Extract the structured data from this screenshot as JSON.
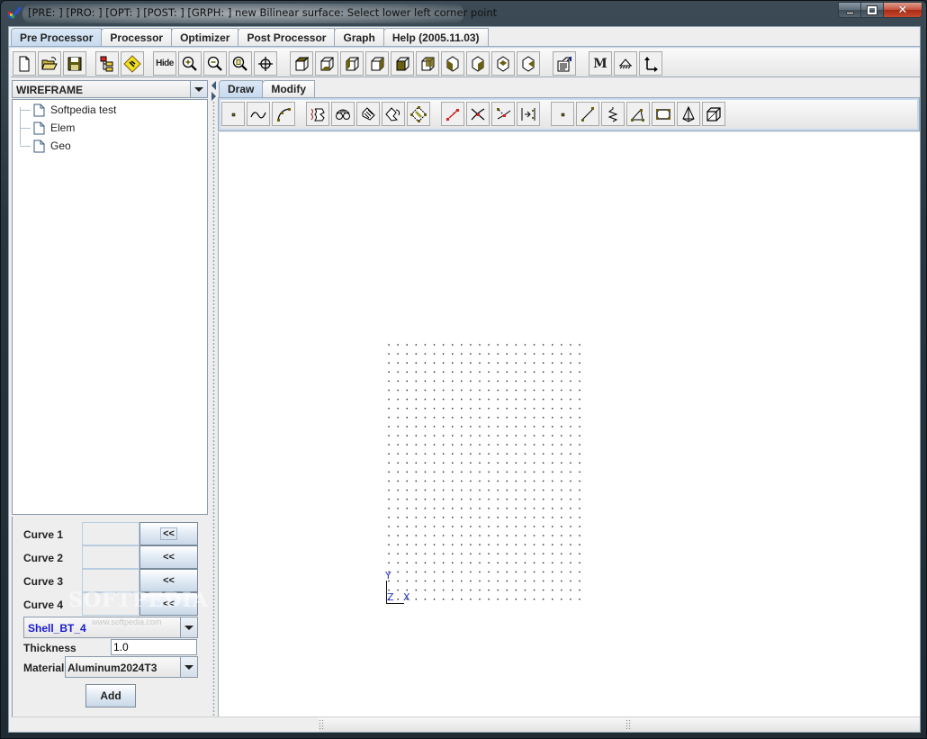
{
  "window": {
    "title": "[PRE: ] [PRO: ] [OPT: ] [POST: ] [GRPH: ] new Bilinear surface: Select lower left corner point",
    "controls": {
      "minimize": "minimize",
      "maximize": "maximize",
      "close": "close"
    }
  },
  "main_tabs": [
    {
      "label": "Pre Processor",
      "active": true
    },
    {
      "label": "Processor",
      "active": false
    },
    {
      "label": "Optimizer",
      "active": false
    },
    {
      "label": "Post Processor",
      "active": false
    },
    {
      "label": "Graph",
      "active": false
    },
    {
      "label": "Help (2005.11.03)",
      "active": false
    }
  ],
  "main_toolbar": {
    "buttons": [
      {
        "icon": "new-file-icon"
      },
      {
        "icon": "open-folder-icon"
      },
      {
        "icon": "save-icon"
      },
      {
        "icon": "tree-hierarchy-icon"
      },
      {
        "icon": "warning-sign-icon"
      },
      {
        "icon": "hide-icon",
        "label": "Hide"
      },
      {
        "icon": "zoom-in-icon"
      },
      {
        "icon": "zoom-out-icon"
      },
      {
        "icon": "zoom-fit-icon"
      },
      {
        "icon": "crosshair-icon"
      },
      {
        "icon": "view-top-icon"
      },
      {
        "icon": "view-bottom-icon"
      },
      {
        "icon": "view-left-icon"
      },
      {
        "icon": "view-right-icon"
      },
      {
        "icon": "view-front-icon"
      },
      {
        "icon": "view-back-icon"
      },
      {
        "icon": "iso-view-1-icon"
      },
      {
        "icon": "iso-view-2-icon"
      },
      {
        "icon": "iso-view-3-icon"
      },
      {
        "icon": "iso-view-4-icon"
      },
      {
        "icon": "properties-icon"
      },
      {
        "icon": "material-icon",
        "label": "M"
      },
      {
        "icon": "boundary-support-icon"
      },
      {
        "icon": "coordinate-axes-icon"
      }
    ]
  },
  "left_panel": {
    "view_mode": "WIREFRAME",
    "tree": [
      {
        "label": "Softpedia test"
      },
      {
        "label": "Elem"
      },
      {
        "label": "Geo"
      }
    ],
    "form": {
      "curves": [
        {
          "label": "Curve 1",
          "value": "",
          "button": "<<"
        },
        {
          "label": "Curve 2",
          "value": "",
          "button": "<<"
        },
        {
          "label": "Curve 3",
          "value": "",
          "button": "<<"
        },
        {
          "label": "Curve 4",
          "value": "",
          "button": "<<"
        }
      ],
      "element_type": "Shell_BT_4",
      "thickness_label": "Thickness",
      "thickness_value": "1.0",
      "material_label": "Material",
      "material_value": "Aluminum2024T3",
      "add_button": "Add"
    },
    "watermark": "SOFTPEDIA",
    "watermark_url": "www.softpedia.com"
  },
  "right_panel": {
    "sub_tabs": [
      {
        "label": "Draw",
        "active": true
      },
      {
        "label": "Modify",
        "active": false
      }
    ],
    "draw_toolbar": {
      "buttons": [
        {
          "icon": "point-icon"
        },
        {
          "icon": "spline-curve-icon"
        },
        {
          "icon": "arc-icon"
        },
        {
          "icon": "sweep-surface-icon"
        },
        {
          "icon": "loft-surface-icon"
        },
        {
          "icon": "ruled-surface-icon"
        },
        {
          "icon": "revolve-surface-icon"
        },
        {
          "icon": "bilinear-surface-icon"
        },
        {
          "icon": "split-curve-icon"
        },
        {
          "icon": "intersect-icon"
        },
        {
          "icon": "project-point-icon"
        },
        {
          "icon": "offset-icon"
        },
        {
          "icon": "node-icon"
        },
        {
          "icon": "line-element-icon"
        },
        {
          "icon": "spring-element-icon"
        },
        {
          "icon": "triangle-element-icon"
        },
        {
          "icon": "quad-element-icon"
        },
        {
          "icon": "tetra-element-icon"
        },
        {
          "icon": "hexa-element-icon"
        }
      ]
    },
    "canvas": {
      "axes": {
        "x": "X",
        "y": "Y",
        "z": "Z"
      }
    }
  }
}
